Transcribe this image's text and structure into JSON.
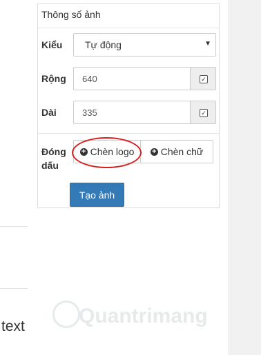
{
  "panel": {
    "title": "Thông số ảnh",
    "style": {
      "label": "Kiểu",
      "value": "Tự động"
    },
    "width": {
      "label": "Rộng",
      "value": "640",
      "checked": true
    },
    "height": {
      "label": "Dài",
      "value": "335",
      "checked": true
    },
    "watermark": {
      "label_line1": "Đóng",
      "label_line2": "dấu",
      "insert_logo": "Chèn logo",
      "insert_text": "Chèn chữ"
    },
    "create_button": "Tạo ảnh"
  },
  "left": {
    "text": "text"
  },
  "brand_watermark": "Quantrimang",
  "colors": {
    "primary": "#337ab7",
    "highlight": "#d62020"
  },
  "icons": {
    "plus": "plus-circle-icon",
    "check": "checkbox-checked-icon",
    "caret": "caret-down-icon"
  }
}
